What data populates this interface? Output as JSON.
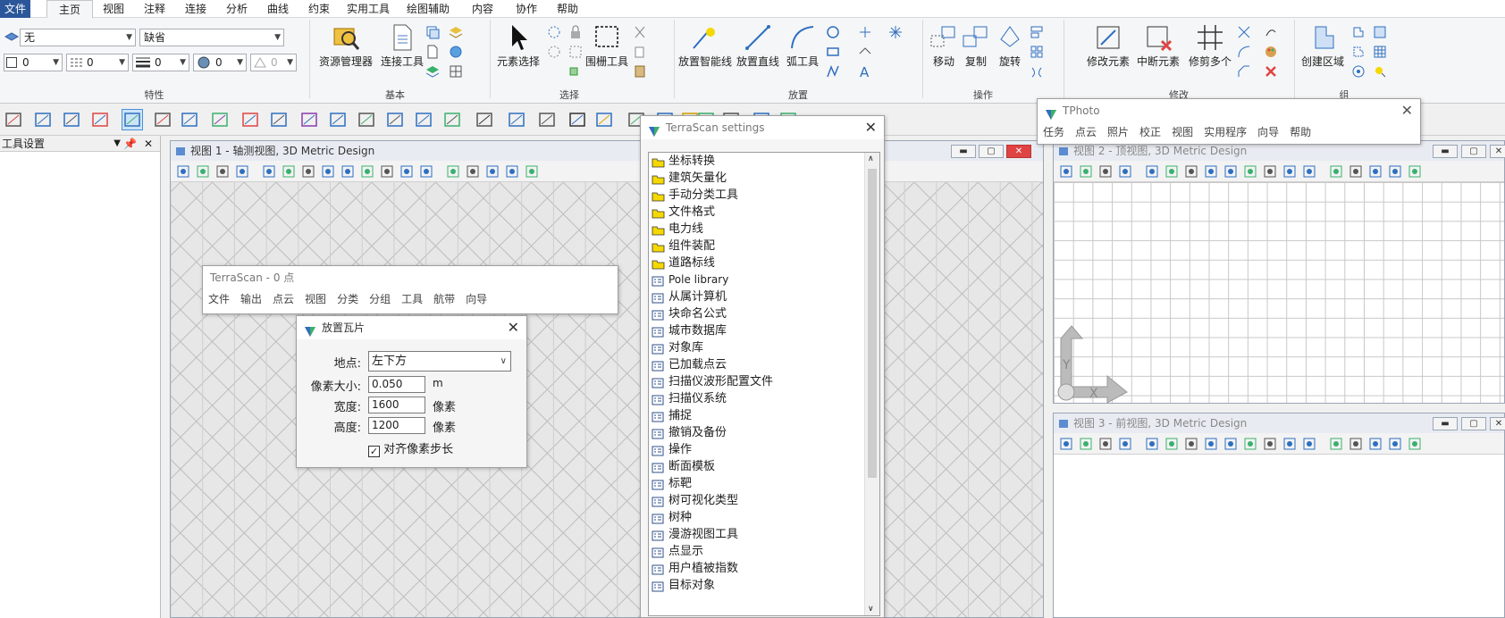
{
  "menubar": {
    "tabs": [
      "文件",
      "主页",
      "视图",
      "注释",
      "连接",
      "分析",
      "曲线",
      "约束",
      "实用工具",
      "绘图辅助",
      "内容",
      "协作",
      "帮助"
    ],
    "active": "主页"
  },
  "ribbon": {
    "props": {
      "level": "无",
      "style": "缺省",
      "color": "0",
      "line_style": "0",
      "weight": "0",
      "transparency": "0",
      "priority": "0",
      "label": "特性"
    },
    "basic": {
      "resource_manager": "资源管理器",
      "connect_tools": "连接工具",
      "label": "基本"
    },
    "select": {
      "element_select": "元素选择",
      "fence_tool": "围栅工具",
      "label": "选择"
    },
    "place": {
      "smart_line": "放置智能线",
      "line": "放置直线",
      "arc": "弧工具",
      "label": "放置"
    },
    "operate": {
      "move": "移动",
      "copy": "复制",
      "rotate": "旋转",
      "label": "操作"
    },
    "modify": {
      "modify_element": "修改元素",
      "break_element": "中断元素",
      "trim_multiple": "修剪多个",
      "label": "修改"
    },
    "group": {
      "create_region": "创建区域",
      "label": "组"
    }
  },
  "left_panel": {
    "title": "工具设置"
  },
  "view1": {
    "title": "视图 1 - 轴测视图, 3D Metric Design"
  },
  "view2": {
    "title": "视图 2 - 顶视图, 3D Metric Design"
  },
  "view3": {
    "title": "视图 3 - 前视图, 3D Metric Design"
  },
  "terrascan_bar": {
    "title": "TerraScan - 0 点",
    "menu": [
      "文件",
      "输出",
      "点云",
      "视图",
      "分类",
      "分组",
      "工具",
      "航带",
      "向导"
    ]
  },
  "tile_dialog": {
    "title": "放置瓦片",
    "location_label": "地点:",
    "location_value": "左下方",
    "pixel_label": "像素大小:",
    "pixel_value": "0.050",
    "pixel_unit": "m",
    "width_label": "宽度:",
    "width_value": "1600",
    "width_unit": "像素",
    "height_label": "高度:",
    "height_value": "1200",
    "height_unit": "像素",
    "align_label": "对齐像素步长",
    "align_checked": true
  },
  "settings": {
    "title": "TerraScan settings",
    "folders": [
      "坐标转换",
      "建筑矢量化",
      "手动分类工具",
      "文件格式",
      "电力线",
      "组件装配",
      "道路标线"
    ],
    "items": [
      "Pole library",
      "从属计算机",
      "块命名公式",
      "城市数据库",
      "对象库",
      "已加载点云",
      "扫描仪波形配置文件",
      "扫描仪系统",
      "捕捉",
      "撤销及备份",
      "操作",
      "断面模板",
      "标靶",
      "树可视化类型",
      "树种",
      "漫游视图工具",
      "点显示",
      "用户植被指数",
      "目标对象"
    ]
  },
  "tphoto": {
    "title": "TPhoto",
    "menu": [
      "任务",
      "点云",
      "照片",
      "校正",
      "视图",
      "实用程序",
      "向导",
      "帮助"
    ]
  },
  "colors": {
    "accent": "#2b579a",
    "folder": "#f5d800",
    "close": "#e04343"
  }
}
